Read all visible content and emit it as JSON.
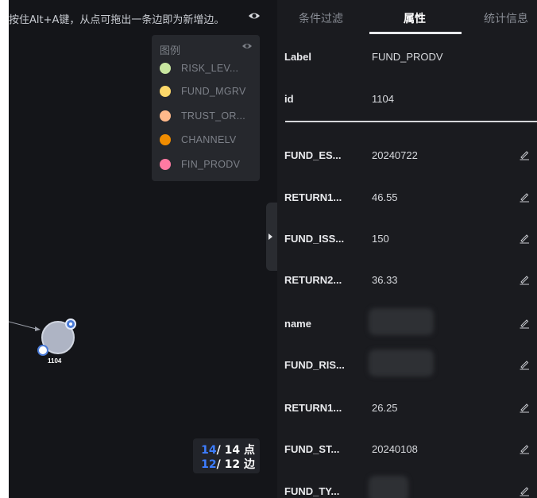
{
  "canvas": {
    "hint_text": "按住Alt+A键，从点可拖出一条边即为新增边。",
    "hint_icon": "eye-icon",
    "legend": {
      "title": "图例",
      "toggle_icon": "eye-icon",
      "items": [
        {
          "label": "RISK_LEV...",
          "color": "#c8e6a0"
        },
        {
          "label": "FUND_MGRV",
          "color": "#fdd86a"
        },
        {
          "label": "TRUST_OR...",
          "color": "#ffb98a"
        },
        {
          "label": "CHANNELV",
          "color": "#f08c00"
        },
        {
          "label": "FIN_PRODV",
          "color": "#ff7aa2"
        }
      ]
    },
    "node": {
      "label": "1104",
      "color": "#aeb4c4"
    },
    "counts": {
      "nodes_shown": "14",
      "nodes_total": "/ 14 点",
      "edges_shown": "12",
      "edges_total": "/ 12 边"
    }
  },
  "panel": {
    "tabs": [
      {
        "label": "条件过滤",
        "active": false
      },
      {
        "label": "属性",
        "active": true
      },
      {
        "label": "统计信息",
        "active": false
      }
    ],
    "fixed": [
      {
        "key": "Label",
        "value": "FUND_PRODV"
      },
      {
        "key": "id",
        "value": "1104"
      }
    ],
    "props": [
      {
        "key": "FUND_ES...",
        "value": "20240722"
      },
      {
        "key": "RETURN1...",
        "value": "46.55"
      },
      {
        "key": "FUND_ISS...",
        "value": "150"
      },
      {
        "key": "RETURN2...",
        "value": "36.33"
      },
      {
        "key": "name",
        "value": ""
      },
      {
        "key": "FUND_RIS...",
        "value": ""
      },
      {
        "key": "RETURN1...",
        "value": "26.25"
      },
      {
        "key": "FUND_ST...",
        "value": "20240108"
      },
      {
        "key": "FUND_TY...",
        "value": ""
      }
    ],
    "edit_icon": "pencil-icon",
    "collapse_icon": "caret-right-icon"
  }
}
